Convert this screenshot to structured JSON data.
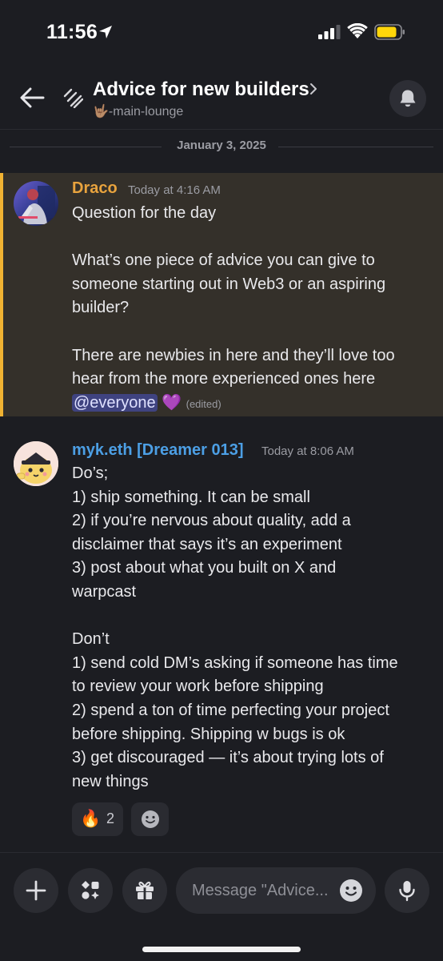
{
  "status_bar": {
    "time": "11:56"
  },
  "header": {
    "title": "Advice for new builders",
    "channel": "🤟🏽-main-lounge"
  },
  "date_divider": "January 3, 2025",
  "messages": [
    {
      "author": "Draco",
      "author_color": "#e8a33e",
      "timestamp": "Today at 4:16 AM",
      "lines": [
        "Question for the day",
        "",
        "What’s one piece of advice you can give to",
        "someone starting out in Web3 or an aspiring",
        "builder?",
        "",
        "There are newbies in here and they’ll love too",
        "hear from the more experienced ones here"
      ],
      "mention": "@everyone",
      "emoji": "💜",
      "edited_label": "(edited)"
    },
    {
      "author": "myk.eth [Dreamer 013]",
      "author_color": "#4c9fe5",
      "timestamp": "Today at 8:06 AM",
      "lines": [
        "Do’s;",
        "1) ship something. It can be small",
        "2) if you’re nervous about quality, add a",
        "disclaimer that says it’s an experiment",
        "3) post about what you built on X and",
        "warpcast",
        "",
        "Don’t",
        "1) send cold DM’s asking if someone has time",
        "to review your work before shipping",
        "2) spend a ton of time perfecting your project",
        "before shipping. Shipping w bugs is ok",
        "3) get discouraged — it’s about trying lots of",
        "new things"
      ],
      "reactions": [
        {
          "emoji": "🔥",
          "count": "2"
        }
      ]
    }
  ],
  "composer": {
    "placeholder": "Message \"Advice..."
  },
  "colors": {
    "highlight_bg": "#34302a",
    "highlight_border": "#f0b232",
    "mention_bg": "#3f4380"
  }
}
